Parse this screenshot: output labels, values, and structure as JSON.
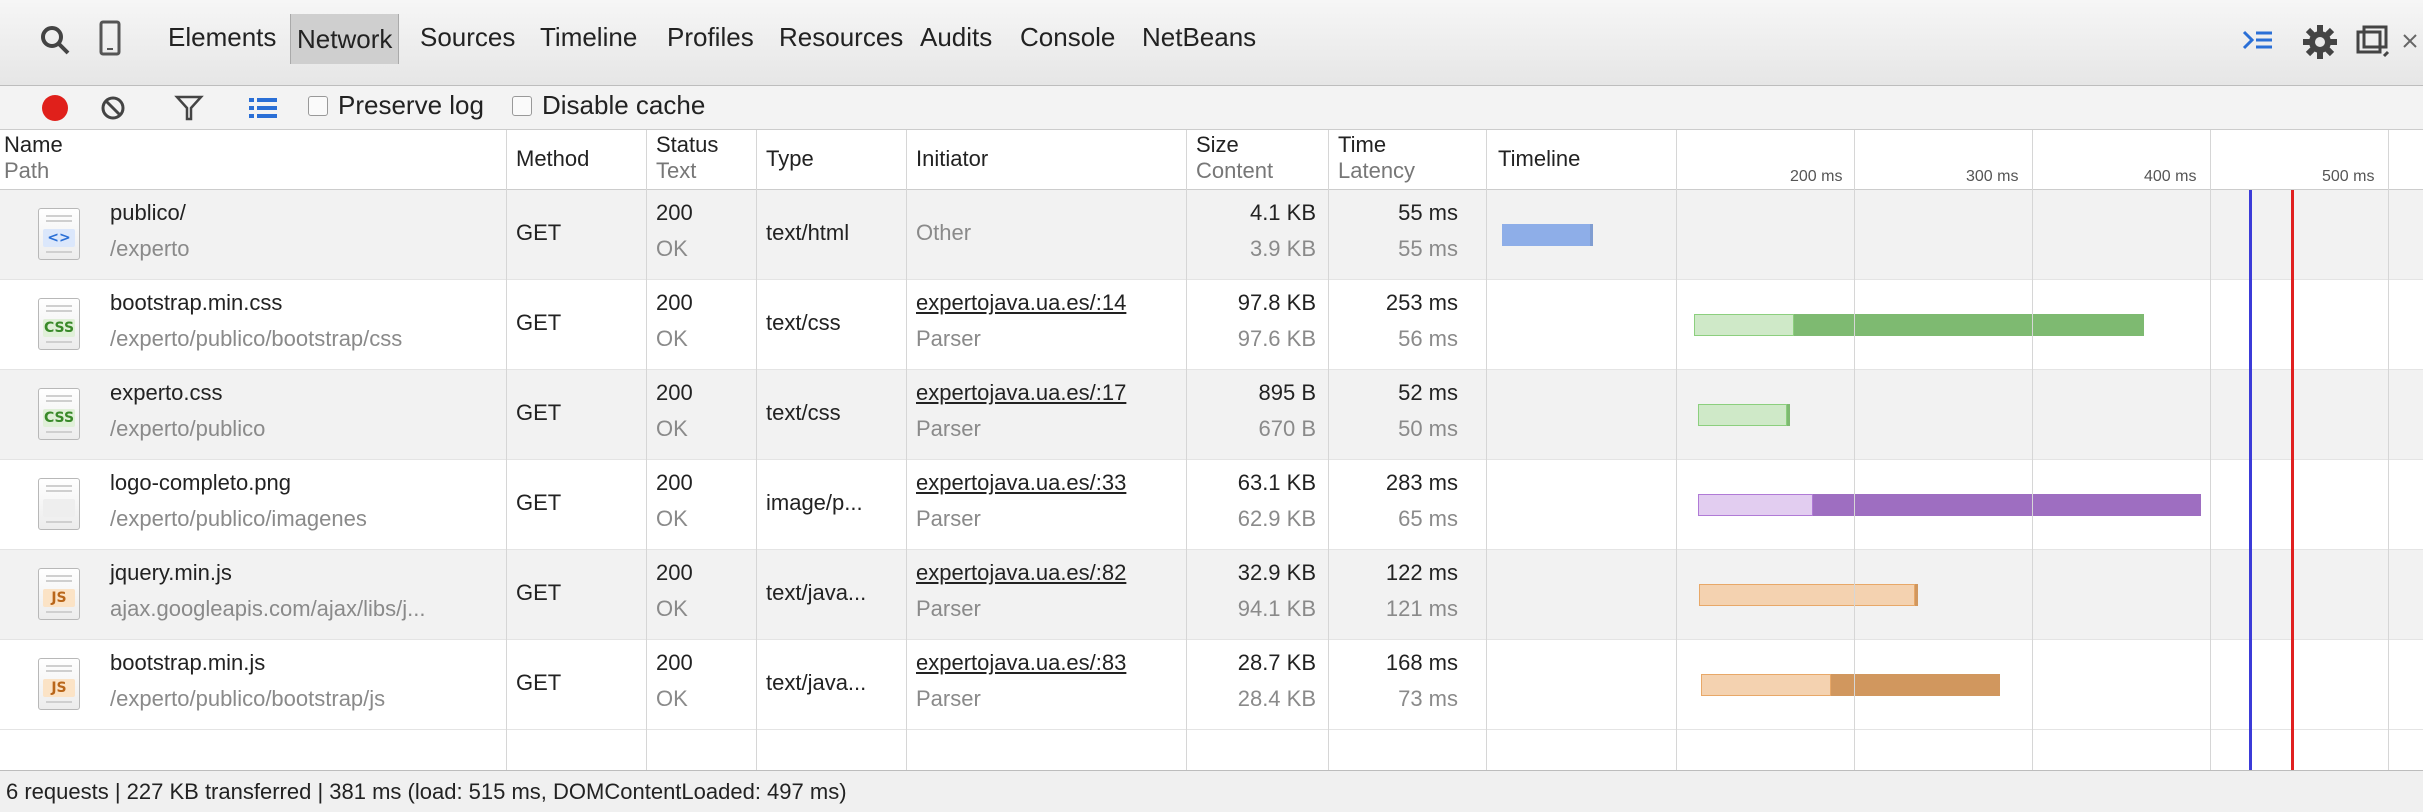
{
  "tabs": [
    "Elements",
    "Network",
    "Sources",
    "Timeline",
    "Profiles",
    "Resources",
    "Audits",
    "Console",
    "NetBeans"
  ],
  "toolbar": {
    "preserve_log_label": "Preserve log",
    "disable_cache_label": "Disable cache"
  },
  "columns": {
    "name": "Name",
    "path": "Path",
    "method": "Method",
    "status": "Status",
    "text": "Text",
    "type": "Type",
    "initiator": "Initiator",
    "size": "Size",
    "content": "Content",
    "time": "Time",
    "latency": "Latency",
    "timeline": "Timeline"
  },
  "timeline_ticks": [
    "200 ms",
    "300 ms",
    "400 ms",
    "500 ms"
  ],
  "requests": [
    {
      "name": "publico/",
      "path": "/experto",
      "method": "GET",
      "status": "200",
      "status_text": "OK",
      "type": "text/html",
      "initiator": "Other",
      "initiator_sub": "",
      "size": "4.1 KB",
      "content": "3.9 KB",
      "time": "55 ms",
      "latency": "55 ms",
      "icon": "html-file-icon",
      "bar_color": "#8eaee8",
      "bar_light": "#c6d6f4",
      "bar_start_ms": 0,
      "bar_latency_end_ms": 55,
      "bar_end_ms": 55
    },
    {
      "name": "bootstrap.min.css",
      "path": "/experto/publico/bootstrap/css",
      "method": "GET",
      "status": "200",
      "status_text": "OK",
      "type": "text/css",
      "initiator": "expertojava.ua.es/:14",
      "initiator_sub": "Parser",
      "size": "97.8 KB",
      "content": "97.6 KB",
      "time": "253 ms",
      "latency": "56 ms",
      "icon": "css-file-icon",
      "bar_color": "#8ccf7e",
      "bar_light": "#cfe9c8",
      "bar_start_ms": 109,
      "bar_latency_end_ms": 165,
      "bar_end_ms": 362
    },
    {
      "name": "experto.css",
      "path": "/experto/publico",
      "method": "GET",
      "status": "200",
      "status_text": "OK",
      "type": "text/css",
      "initiator": "expertojava.ua.es/:17",
      "initiator_sub": "Parser",
      "size": "895 B",
      "content": "670 B",
      "time": "52 ms",
      "latency": "50 ms",
      "icon": "css-file-icon",
      "bar_color": "#8ccf7e",
      "bar_light": "#cfe9c8",
      "bar_start_ms": 111,
      "bar_latency_end_ms": 161,
      "bar_end_ms": 163
    },
    {
      "name": "logo-completo.png",
      "path": "/experto/publico/imagenes",
      "method": "GET",
      "status": "200",
      "status_text": "OK",
      "type": "image/p...",
      "initiator": "expertojava.ua.es/:33",
      "initiator_sub": "Parser",
      "size": "63.1 KB",
      "content": "62.9 KB",
      "time": "283 ms",
      "latency": "65 ms",
      "icon": "image-file-icon",
      "bar_color": "#b07ad6",
      "bar_light": "#e2cdf0",
      "bar_start_ms": 111,
      "bar_latency_end_ms": 176,
      "bar_end_ms": 394
    },
    {
      "name": "jquery.min.js",
      "path": "ajax.googleapis.com/ajax/libs/j...",
      "method": "GET",
      "status": "200",
      "status_text": "OK",
      "type": "text/java...",
      "initiator": "expertojava.ua.es/:82",
      "initiator_sub": "Parser",
      "size": "32.9 KB",
      "content": "94.1 KB",
      "time": "122 ms",
      "latency": "121 ms",
      "icon": "js-file-icon",
      "bar_color": "#e8a868",
      "bar_light": "#f4d2b0",
      "bar_start_ms": 112,
      "bar_latency_end_ms": 233,
      "bar_end_ms": 234
    },
    {
      "name": "bootstrap.min.js",
      "path": "/experto/publico/bootstrap/js",
      "method": "GET",
      "status": "200",
      "status_text": "OK",
      "type": "text/java...",
      "initiator": "expertojava.ua.es/:83",
      "initiator_sub": "Parser",
      "size": "28.7 KB",
      "content": "28.4 KB",
      "time": "168 ms",
      "latency": "73 ms",
      "icon": "js-file-icon",
      "bar_color": "#e8a868",
      "bar_light": "#f4d2b0",
      "bar_start_ms": 113,
      "bar_latency_end_ms": 186,
      "bar_end_ms": 281
    }
  ],
  "footer": {
    "summary": "6 requests | 227 KB transferred | 381 ms (load: 515 ms, DOMContentLoaded: 497 ms)",
    "domcontentloaded_ms": 497,
    "load_ms": 515
  }
}
